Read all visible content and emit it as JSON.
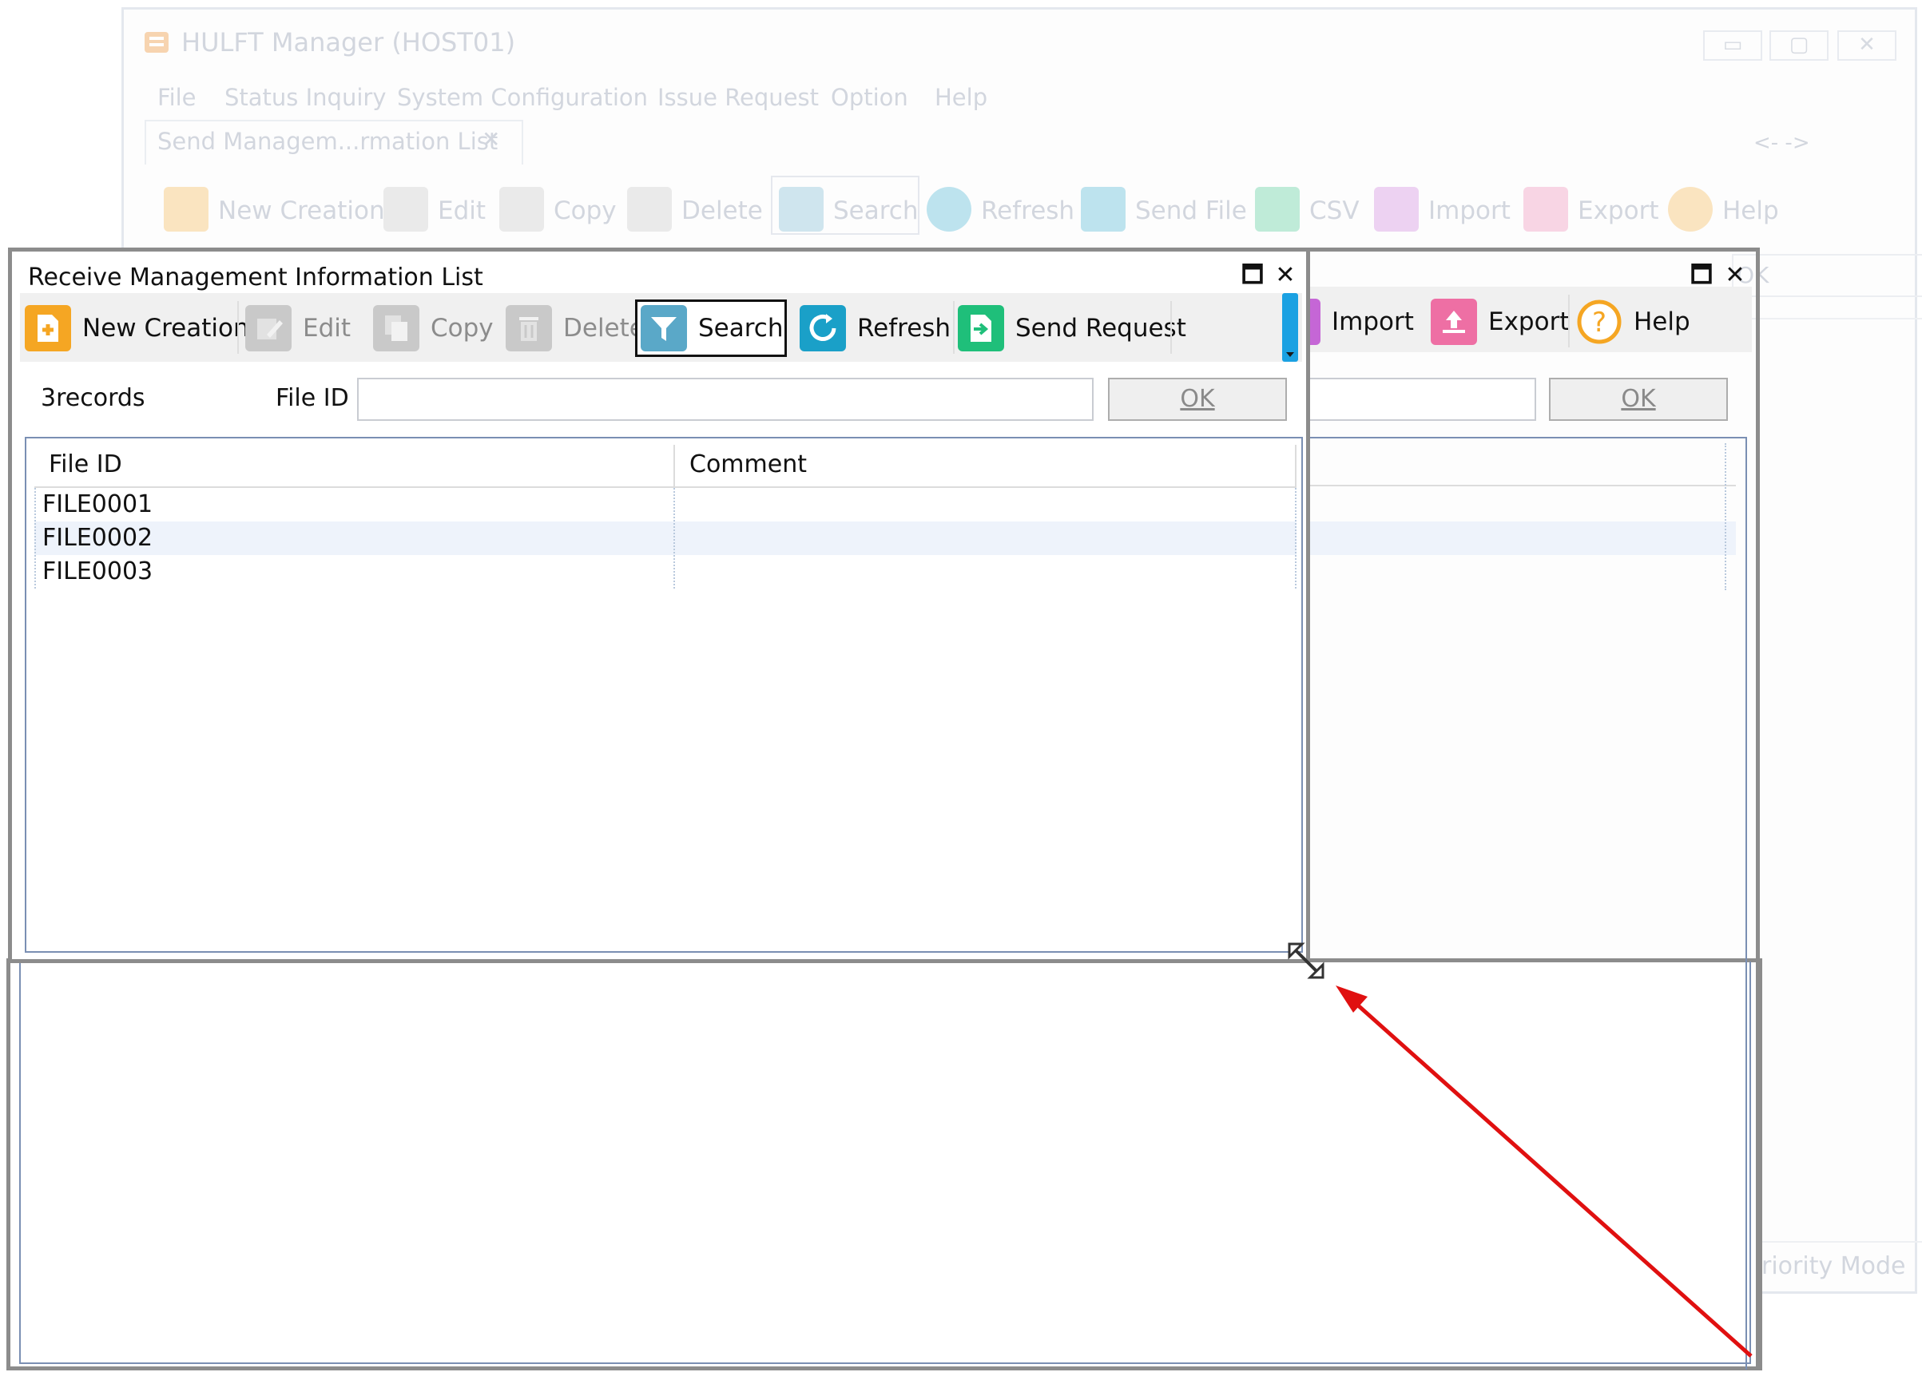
{
  "background_window": {
    "title": "HULFT Manager (HOST01)",
    "menu": [
      "File",
      "Status Inquiry",
      "System Configuration",
      "Issue Request",
      "Option",
      "Help"
    ],
    "tab": {
      "label": "Send Managem...rmation List",
      "close": "✕"
    },
    "nav": "<-  ->",
    "toolbar": [
      "New Creation",
      "Edit",
      "Copy",
      "Delete",
      "Search",
      "Refresh",
      "Send File",
      "CSV",
      "Import",
      "Export",
      "Help"
    ],
    "ok_label": "OK",
    "status_text": "riority Mode"
  },
  "dialog": {
    "title": "Receive Management Information List",
    "maximize": "🗖",
    "close": "✕",
    "toolbar": {
      "new_creation": "New Creation",
      "edit": "Edit",
      "copy": "Copy",
      "delete": "Delete",
      "search": "Search",
      "refresh": "Refresh",
      "send_request": "Send Request",
      "import": "Import",
      "export": "Export",
      "help": "Help"
    },
    "record_count": "3records",
    "file_id_label": "File ID",
    "file_id_value": "",
    "ok_label": "OK",
    "grid": {
      "columns": [
        "File ID",
        "Comment"
      ],
      "rows": [
        {
          "file_id": "FILE0001",
          "comment": ""
        },
        {
          "file_id": "FILE0002",
          "comment": ""
        },
        {
          "file_id": "FILE0003",
          "comment": ""
        }
      ]
    }
  },
  "colors": {
    "new_creation": "#f5a623",
    "search": "#5aa8c8",
    "refresh": "#1aa0c8",
    "send_request": "#1fbf7a",
    "import": "#c566d6",
    "export": "#ee6fa4",
    "help": "#f5a623",
    "arrow": "#e01010"
  }
}
